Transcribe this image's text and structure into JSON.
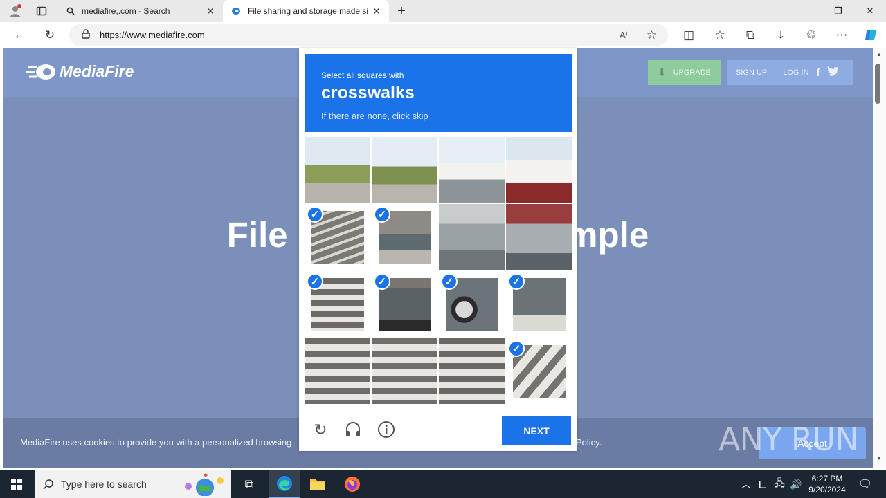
{
  "browser": {
    "tabs": [
      {
        "title": "mediafire,.com - Search"
      },
      {
        "title": "File sharing and storage made si"
      }
    ],
    "url": "https://www.mediafire.com"
  },
  "site": {
    "logo_text": "MediaFire",
    "upgrade_label": "UPGRADE",
    "signup_label": "SIGN UP",
    "login_label": "LOG IN",
    "hero_title": "File storage made simple",
    "cookie_text": "MediaFire uses cookies to provide you with a personalized browsing",
    "cookie_policy": "Policy.",
    "accept_label": "Accept"
  },
  "captcha": {
    "instruction": "Select all squares with",
    "target": "crosswalks",
    "hint": "If there are none, click skip",
    "next_label": "NEXT",
    "selected": [
      false,
      false,
      false,
      false,
      true,
      true,
      false,
      false,
      true,
      true,
      true,
      true,
      false,
      false,
      false,
      true
    ]
  },
  "watermark": "ANY RUN",
  "taskbar": {
    "search_placeholder": "Type here to search",
    "time": "6:27 PM",
    "date": "9/20/2024"
  },
  "colors": {
    "accent": "#1a73e8",
    "page_bg": "#7a8fba",
    "upgrade": "#8fcc9c"
  }
}
